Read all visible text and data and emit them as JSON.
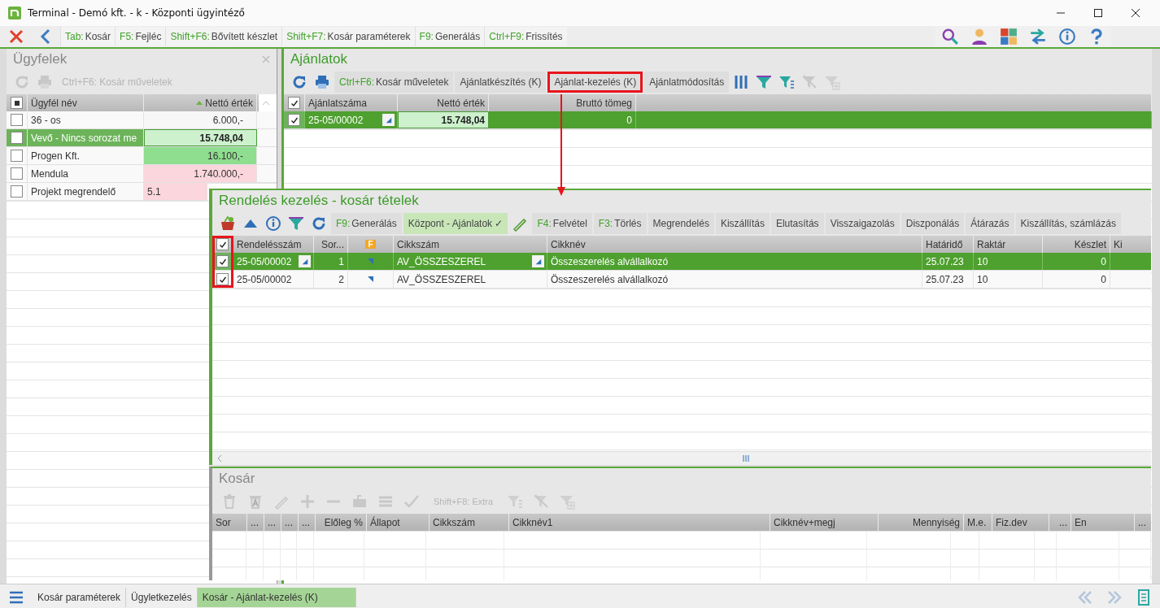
{
  "window": {
    "title": "Terminal - Demó kft. - k - Központi ügyintéző"
  },
  "toolbar": {
    "items": [
      {
        "key": "Tab:",
        "label": "Kosár"
      },
      {
        "key": "F5:",
        "label": "Fejléc"
      },
      {
        "key": "Shift+F6:",
        "label": "Bővített készlet"
      },
      {
        "key": "Shift+F7:",
        "label": "Kosár paraméterek"
      },
      {
        "key": "F9:",
        "label": "Generálás"
      },
      {
        "key": "Ctrl+F9:",
        "label": "Frissítés"
      }
    ]
  },
  "customers": {
    "title": "Ügyfelek",
    "action": "Ctrl+F6: Kosár műveletek",
    "header_indeterminate": true,
    "columns": [
      {
        "label": "Ügyfél név",
        "sorted_ascending": false
      },
      {
        "label": "Nettó érték",
        "sorted_ascending": true
      }
    ],
    "rows": [
      {
        "checked": false,
        "selected": false,
        "name": "36 - os",
        "value": "6.000,-",
        "color": "#f7f7f7"
      },
      {
        "checked": false,
        "selected": true,
        "name": "Vevő - Nincs sorozat me",
        "value": "15.748,04",
        "color": "#cdf0cd"
      },
      {
        "checked": false,
        "selected": false,
        "name": "Progen Kft.",
        "value": "16.100,-",
        "color": "#8fdd8f"
      },
      {
        "checked": false,
        "selected": false,
        "name": "Mendula",
        "value": "1.740.000,-",
        "color": "#fbd6dc"
      },
      {
        "checked": false,
        "selected": false,
        "name": "Projekt megrendelő",
        "value": "5.1",
        "color": "#fbd6dc"
      }
    ]
  },
  "offers": {
    "title": "Ajánlatok",
    "buttons": [
      {
        "key": "Ctrl+F6:",
        "label": "Kosár műveletek",
        "highlighted": false
      },
      {
        "label": "Ajánlatkészítés (K)",
        "highlighted": false
      },
      {
        "label": "Ajánlat-kezelés (K)",
        "highlighted": true
      },
      {
        "label": "Ajánlatmódosítás",
        "highlighted": false
      }
    ],
    "table": {
      "header_checked": true,
      "columns": [
        {
          "label": "Ajánlatszáma",
          "kind": "text",
          "dropdown": true
        },
        {
          "label": "Nettó érték",
          "kind": "number",
          "focus": true
        },
        {
          "label": "Bruttó tömeg",
          "kind": "number"
        }
      ],
      "rows": [
        {
          "checked": true,
          "selected": true,
          "cells": [
            "25-05/00002",
            "15.748,04",
            "0"
          ]
        }
      ]
    }
  },
  "order_items": {
    "title": "Rendelés kezelés - kosár tételek",
    "buttons_before": [
      {
        "key": "F9:",
        "label": "Generálás",
        "active": false
      },
      {
        "label": "Központ - Ajánlatok ✓",
        "active": true
      }
    ],
    "buttons_after": [
      {
        "key": "F4:",
        "label": "Felvétel",
        "active": false
      },
      {
        "key": "F3:",
        "label": "Törlés",
        "active": false
      },
      {
        "label": "Megrendelés",
        "active": false
      },
      {
        "label": "Kiszállítás",
        "active": false
      },
      {
        "label": "Elutasítás",
        "active": false
      },
      {
        "label": "Visszaigazolás",
        "active": false
      },
      {
        "label": "Diszponálás",
        "active": false
      },
      {
        "label": "Átárazás",
        "active": false
      },
      {
        "label": "Kiszállítás, számlázás",
        "active": false
      }
    ],
    "table": {
      "header_checked": true,
      "checkbox_column_highlighted": true,
      "columns": [
        {
          "label": "Rendelésszám",
          "kind": "text",
          "dropdown": true
        },
        {
          "label": "Sor...",
          "kind": "number"
        },
        {
          "label": "F",
          "kind": "flag"
        },
        {
          "label": "Cikkszám",
          "kind": "text",
          "dropdown": true
        },
        {
          "label": "Cikknév",
          "kind": "text"
        },
        {
          "label": "Határidő",
          "kind": "text"
        },
        {
          "label": "Raktár",
          "kind": "text"
        },
        {
          "label": "Készlet",
          "kind": "number"
        },
        {
          "label": "Ki",
          "kind": "text"
        }
      ],
      "rows": [
        {
          "checked": true,
          "selected": true,
          "flag": true,
          "cells": [
            "25-05/00002",
            "1",
            null,
            "AV_ÖSSZESZEREL",
            "Összeszerelés alvállalkozó",
            "25.07.23",
            "10",
            "0",
            null
          ]
        },
        {
          "checked": true,
          "selected": false,
          "flag": true,
          "cells": [
            "25-05/00002",
            "2",
            null,
            "AV_ÖSSZESZEREL",
            "Összeszerelés alvállalkozó",
            "25.07.23",
            "10",
            "0",
            null
          ]
        }
      ]
    }
  },
  "basket": {
    "title": "Kosár",
    "action": "Shift+F8: Extra",
    "columns": [
      "Sor",
      "...",
      "...",
      "...",
      "...",
      "Előleg %",
      "Állapot",
      "Cikkszám",
      "Cikknév1",
      "Cikknév+megj",
      "Mennyiség",
      "M.e.",
      "Fiz.dev",
      "...",
      "En",
      "..."
    ]
  },
  "bottom_tabs": [
    {
      "label": "Kosár paraméterek",
      "selected": false
    },
    {
      "label": "Ügyletkezelés",
      "selected": false
    },
    {
      "label": "Kosár - Ajánlat-kezelés (K)",
      "selected": true
    }
  ]
}
